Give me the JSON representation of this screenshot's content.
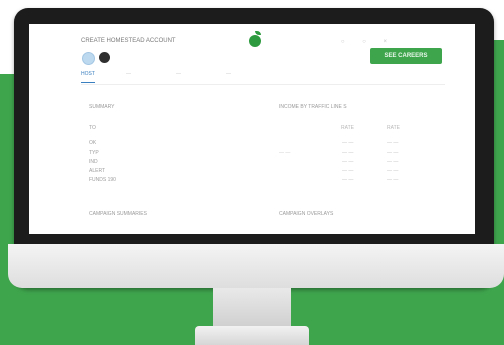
{
  "screen": {
    "app_title": "CREATE HOMESTEAD ACCOUNT",
    "cta_label": "SEE CAREERS",
    "top_icons": [
      "○",
      "○",
      "×"
    ],
    "tabs": [
      "HOST",
      "—",
      "—",
      "—"
    ],
    "section_top_left": "SUMMARY",
    "section_top_right": "INCOME BY TRAFFIC LINE S",
    "col_headers": [
      "RATE",
      "RATE"
    ],
    "rows": [
      {
        "label": "TO",
        "c2": "",
        "c3": "",
        "c4": ""
      },
      {
        "label": "OK",
        "c2": "",
        "c3": "— —",
        "c4": "— —"
      },
      {
        "label": "TYP",
        "c2": "— —",
        "c3": "— —",
        "c4": "— —"
      },
      {
        "label": "IND",
        "c2": "",
        "c3": "— —",
        "c4": "— —"
      },
      {
        "label": "ALERT",
        "c2": "",
        "c3": "— —",
        "c4": "— —"
      },
      {
        "label": "FUNDS 190",
        "c2": "",
        "c3": "— —",
        "c4": "— —"
      }
    ],
    "section_bottom_left": "CAMPAIGN SUMMARIES",
    "section_bottom_right": "CAMPAIGN OVERLAYS",
    "bottom_tabs": [
      "— —",
      "— —",
      "— —",
      "— — —"
    ]
  }
}
